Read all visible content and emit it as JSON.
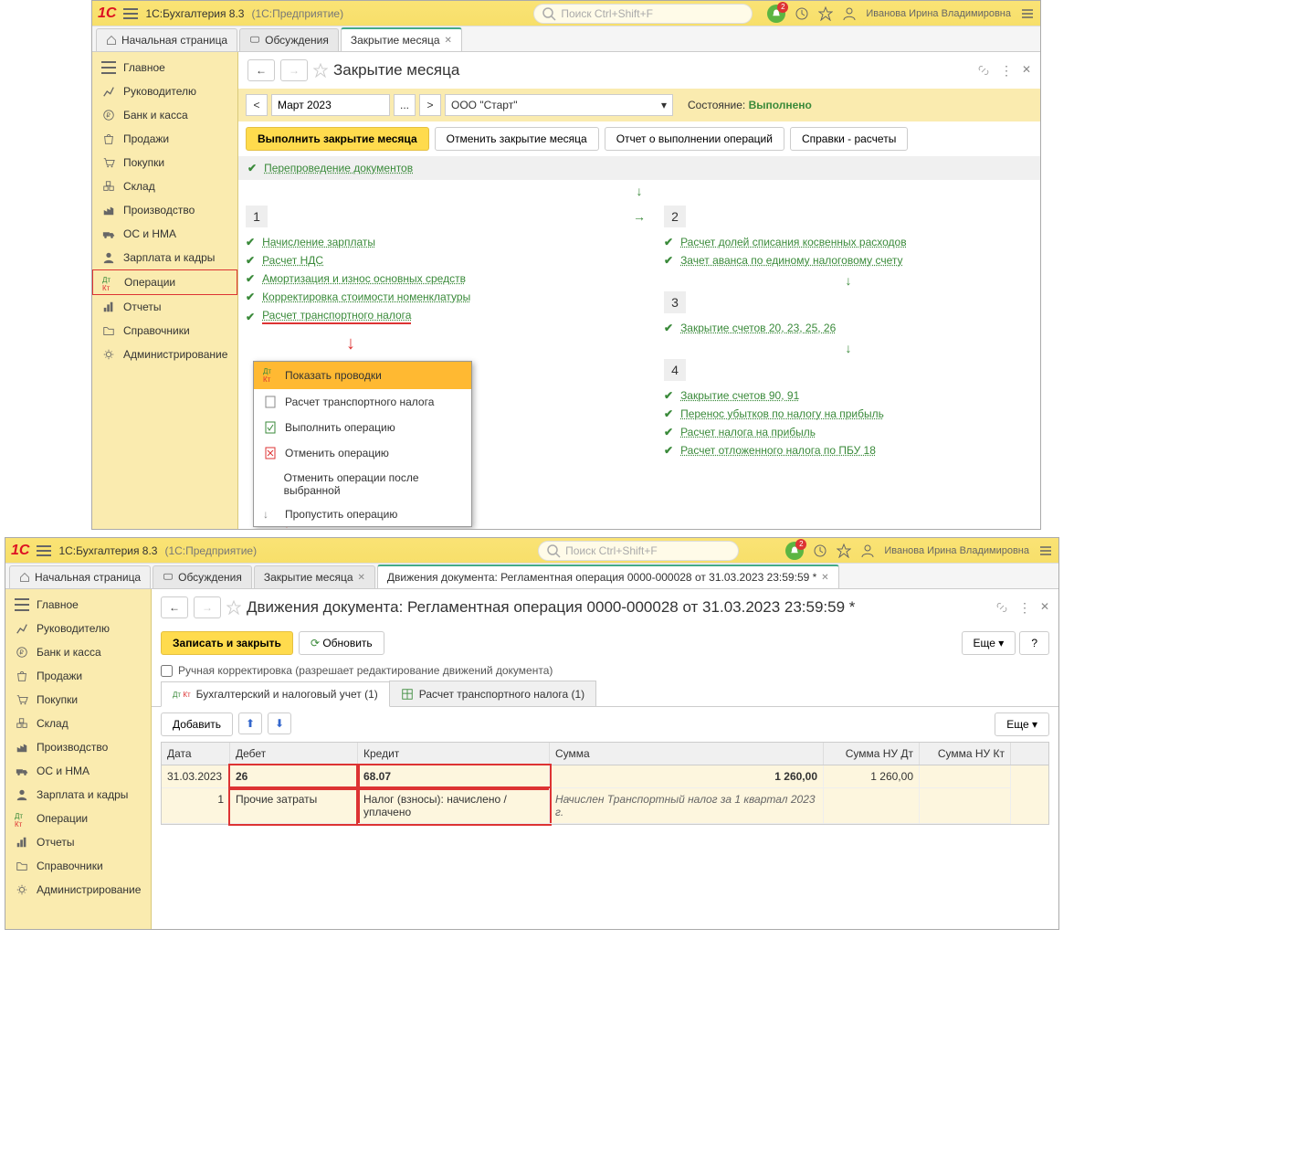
{
  "app": {
    "logo": "1C",
    "title": "1С:Бухгалтерия 8.3",
    "config": "(1С:Предприятие)",
    "search_placeholder": "Поиск Ctrl+Shift+F",
    "user": "Иванова Ирина Владимировна",
    "bell_count": "2"
  },
  "sidebar": {
    "items": [
      "Главное",
      "Руководителю",
      "Банк и касса",
      "Продажи",
      "Покупки",
      "Склад",
      "Производство",
      "ОС и НМА",
      "Зарплата и кадры",
      "Операции",
      "Отчеты",
      "Справочники",
      "Администрирование"
    ]
  },
  "win1": {
    "tabs": {
      "home": "Начальная страница",
      "discuss": "Обсуждения",
      "close": "Закрытие месяца"
    },
    "page_title": "Закрытие месяца",
    "period": "Март 2023",
    "org": "ООО \"Старт\"",
    "status_label": "Состояние:",
    "status_value": "Выполнено",
    "toolbar": {
      "run": "Выполнить закрытие месяца",
      "cancel": "Отменить закрытие месяца",
      "report": "Отчет о выполнении операций",
      "ref": "Справки - расчеты"
    },
    "reprov": "Перепроведение документов",
    "col1": {
      "ops": [
        "Начисление зарплаты",
        "Расчет НДС",
        "Амортизация и износ основных средств",
        "Корректировка стоимости номенклатуры",
        "Расчет транспортного налога"
      ]
    },
    "col2": {
      "s2": [
        "Расчет долей списания косвенных расходов",
        "Зачет аванса по единому налоговому счету"
      ],
      "s3": [
        "Закрытие счетов 20, 23, 25, 26"
      ],
      "s4": [
        "Закрытие счетов 90, 91",
        "Перенос убытков по налогу на прибыль",
        "Расчет налога на прибыль",
        "Расчет отложенного налога по ПБУ 18"
      ]
    },
    "context": {
      "show": "Показать проводки",
      "calc": "Расчет транспортного налога",
      "run": "Выполнить операцию",
      "cancel": "Отменить операцию",
      "cancel_after": "Отменить операции после выбранной",
      "skip": "Пропустить операцию"
    }
  },
  "win2": {
    "tabs": {
      "home": "Начальная страница",
      "discuss": "Обсуждения",
      "close": "Закрытие месяца",
      "doc": "Движения документа: Регламентная операция 0000-000028 от 31.03.2023 23:59:59 *"
    },
    "page_title": "Движения документа: Регламентная операция 0000-000028 от 31.03.2023 23:59:59 *",
    "toolbar": {
      "save": "Записать и закрыть",
      "refresh": "Обновить",
      "more": "Еще",
      "help": "?"
    },
    "manual": "Ручная корректировка (разрешает редактирование движений документа)",
    "inner_tabs": {
      "acc": "Бухгалтерский и налоговый учет (1)",
      "tax": "Расчет транспортного налога (1)"
    },
    "add": "Добавить",
    "grid": {
      "headers": [
        "Дата",
        "Дебет",
        "Кредит",
        "Сумма",
        "Сумма НУ Дт",
        "Сумма НУ Кт"
      ],
      "row1": {
        "date": "31.03.2023",
        "num": "1",
        "deb": "26",
        "kred": "68.07",
        "sum": "1 260,00",
        "nud": "1 260,00"
      },
      "row2": {
        "deb": "Прочие затраты",
        "kred": "Налог (взносы): начислено / уплачено",
        "sum": "Начислен Транспортный налог за 1 квартал 2023 г."
      }
    }
  }
}
